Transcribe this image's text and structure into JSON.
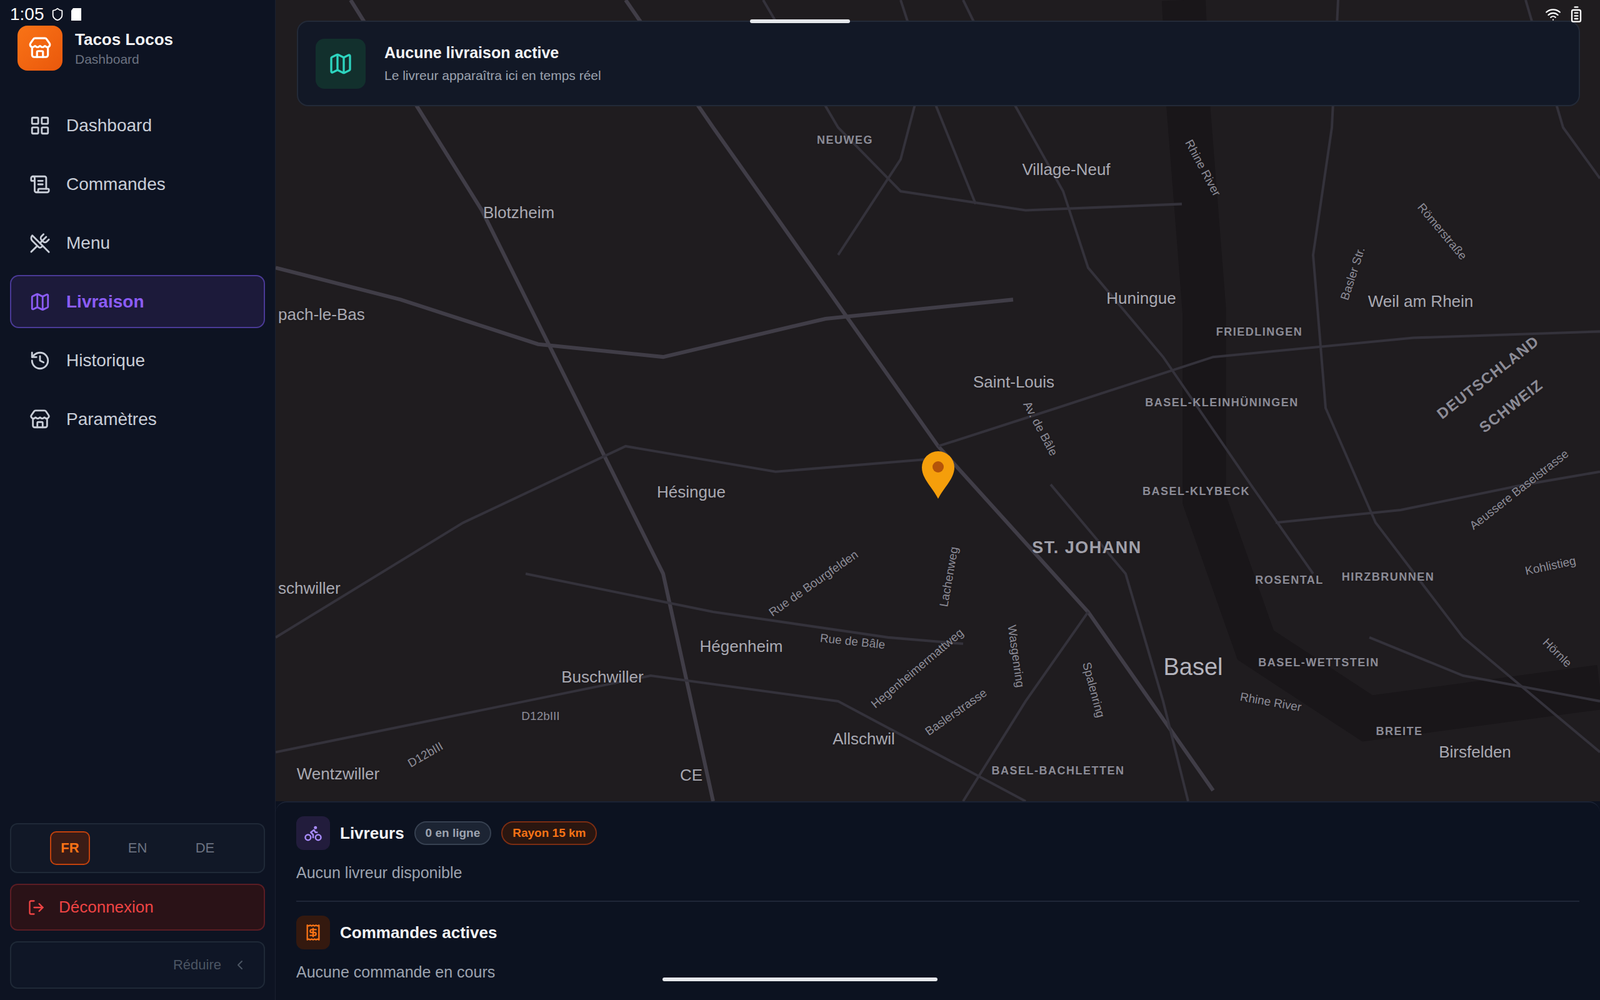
{
  "status_bar": {
    "time": "1:05"
  },
  "app": {
    "name": "Tacos Locos",
    "subtitle": "Dashboard"
  },
  "sidebar": {
    "items": [
      {
        "label": "Dashboard",
        "selected": false
      },
      {
        "label": "Commandes",
        "selected": false
      },
      {
        "label": "Menu",
        "selected": false
      },
      {
        "label": "Livraison",
        "selected": true
      },
      {
        "label": "Historique",
        "selected": false
      },
      {
        "label": "Paramètres",
        "selected": false
      }
    ]
  },
  "languages": [
    {
      "label": "FR",
      "selected": true
    },
    {
      "label": "EN",
      "selected": false
    },
    {
      "label": "DE",
      "selected": false
    }
  ],
  "logout": "Déconnexion",
  "collapse": "Réduire",
  "banner": {
    "title": "Aucune livraison active",
    "subtitle": "Le livreur apparaîtra ici en temps réel"
  },
  "map": {
    "labels": [
      {
        "text": "NEUWEG",
        "kind": "district"
      },
      {
        "text": "Village-Neuf",
        "kind": "city"
      },
      {
        "text": "Blotzheim",
        "kind": "city"
      },
      {
        "text": "Huningue",
        "kind": "city"
      },
      {
        "text": "FRIEDLINGEN",
        "kind": "district"
      },
      {
        "text": "Weil am Rhein",
        "kind": "city"
      },
      {
        "text": "pach-le-Bas",
        "kind": "city"
      },
      {
        "text": "Saint-Louis",
        "kind": "city"
      },
      {
        "text": "BASEL-KLEINHÜNINGEN",
        "kind": "district"
      },
      {
        "text": "Av. de Bâle",
        "kind": "street"
      },
      {
        "text": "DEUTSCHLAND",
        "kind": "country"
      },
      {
        "text": "SCHWEIZ",
        "kind": "country"
      },
      {
        "text": "Basler Str.",
        "kind": "street"
      },
      {
        "text": "Römerstraße",
        "kind": "street"
      },
      {
        "text": "Rhine River",
        "kind": "street"
      },
      {
        "text": "Hésingue",
        "kind": "city"
      },
      {
        "text": "BASEL-KLYBECK",
        "kind": "district"
      },
      {
        "text": "Aeussere Baselstrasse",
        "kind": "street"
      },
      {
        "text": "ST. JOHANN",
        "kind": "area"
      },
      {
        "text": "Rue de Bourgfelden",
        "kind": "street"
      },
      {
        "text": "Lachenweg",
        "kind": "street"
      },
      {
        "text": "schwiller",
        "kind": "city"
      },
      {
        "text": "ROSENTAL",
        "kind": "district"
      },
      {
        "text": "HIRZBRUNNEN",
        "kind": "district"
      },
      {
        "text": "Kohlistieg",
        "kind": "street"
      },
      {
        "text": "Rue de Bâle",
        "kind": "street"
      },
      {
        "text": "Hégenheim",
        "kind": "city"
      },
      {
        "text": "Wasgenring",
        "kind": "street"
      },
      {
        "text": "Hegenheimermattweg",
        "kind": "street"
      },
      {
        "text": "Basel",
        "kind": "major"
      },
      {
        "text": "BASEL-WETTSTEIN",
        "kind": "district"
      },
      {
        "text": "Hörnle",
        "kind": "street"
      },
      {
        "text": "Buschwiller",
        "kind": "city"
      },
      {
        "text": "Spalenring",
        "kind": "street"
      },
      {
        "text": "Rhine River",
        "kind": "street"
      },
      {
        "text": "Baslerstrasse",
        "kind": "street"
      },
      {
        "text": "D12bIII",
        "kind": "road"
      },
      {
        "text": "BREITE",
        "kind": "district"
      },
      {
        "text": "Allschwil",
        "kind": "city"
      },
      {
        "text": "Birsfelden",
        "kind": "city"
      },
      {
        "text": "D12bIII",
        "kind": "road"
      },
      {
        "text": "BASEL-BACHLETTEN",
        "kind": "district"
      },
      {
        "text": "Wentzwiller",
        "kind": "city"
      },
      {
        "text": "CE",
        "kind": "city"
      }
    ]
  },
  "couriers": {
    "title": "Livreurs",
    "online": "0 en ligne",
    "radius": "Rayon 15 km",
    "empty": "Aucun livreur disponible"
  },
  "orders": {
    "title": "Commandes actives",
    "empty": "Aucune commande en cours"
  }
}
